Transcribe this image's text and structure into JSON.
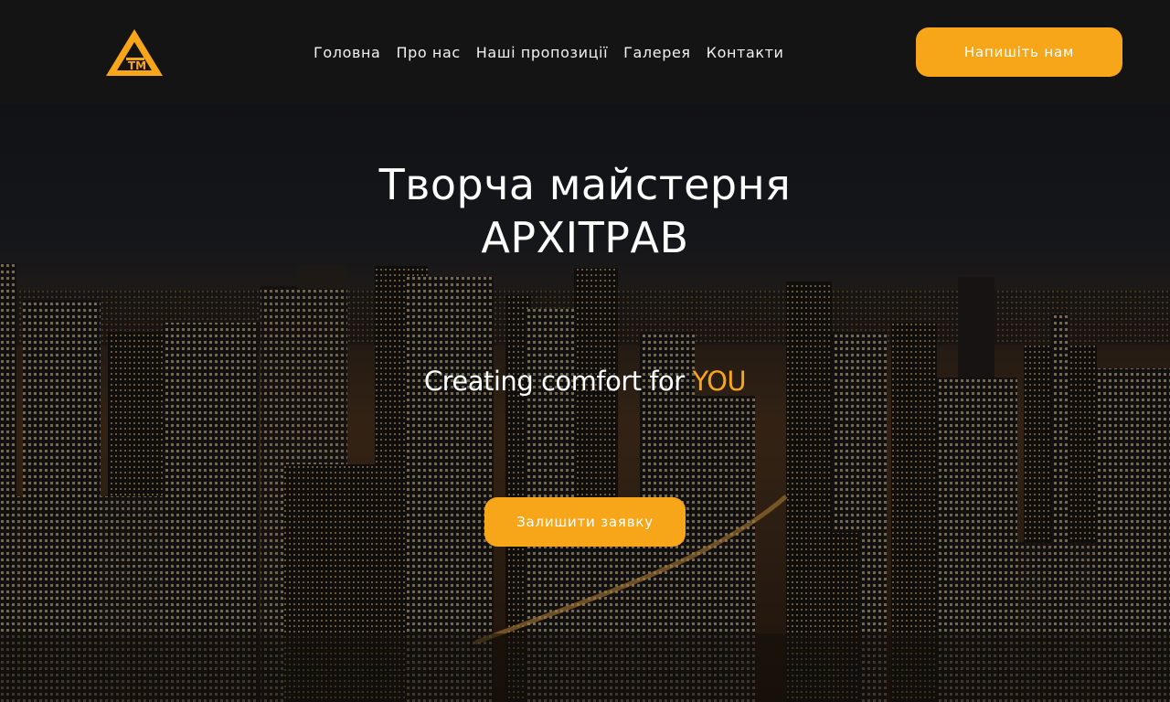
{
  "brand": {
    "logo_text": "ТМ",
    "accent_color": "#f8a619"
  },
  "nav": {
    "items": [
      {
        "label": "Головна"
      },
      {
        "label": "Про нас"
      },
      {
        "label": "Наші пропозиції"
      },
      {
        "label": "Галерея"
      },
      {
        "label": "Контакти"
      }
    ]
  },
  "header": {
    "cta_label": "Напишіть нам"
  },
  "hero": {
    "title_line1": "Творча майстерня",
    "title_line2": "АРХІТРАВ",
    "subtitle_prefix": "Creating comfort for ",
    "subtitle_accent": "YOU",
    "cta_label": "Залишити заявку",
    "background": "night-city-skyline-image"
  }
}
